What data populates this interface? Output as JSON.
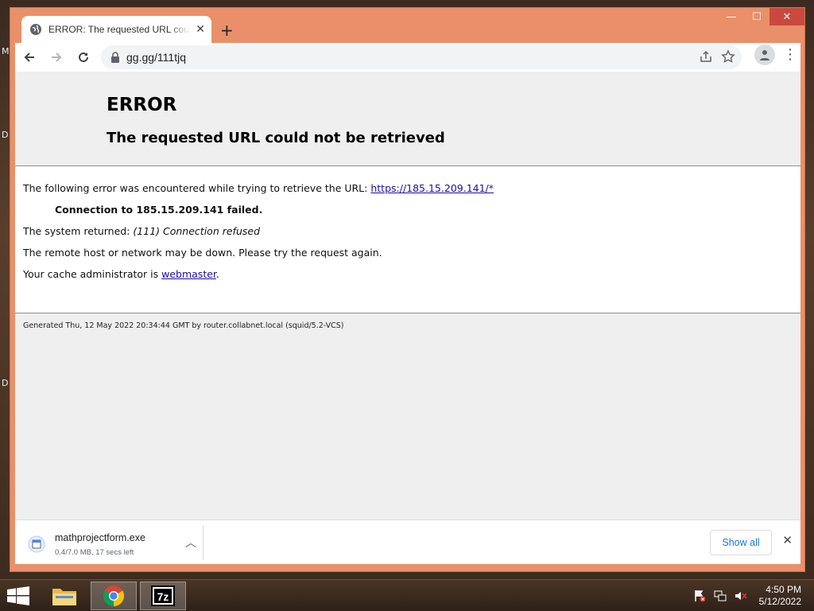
{
  "desktop": {
    "side_letters": [
      "M",
      "D",
      "D"
    ]
  },
  "browser": {
    "tab": {
      "title": "ERROR: The requested URL could not be retrieved",
      "close": "✕"
    },
    "new_tab": "+",
    "window_controls": {
      "minimize": "—",
      "maximize": "☐",
      "close": "✕"
    },
    "address": "gg.gg/111tjq",
    "menu": "⋮"
  },
  "page": {
    "title": "ERROR",
    "subtitle": "The requested URL could not be retrieved",
    "line1_prefix": "The following error was encountered while trying to retrieve the URL: ",
    "line1_link": "https://185.15.209.141/*",
    "connection": "Connection to 185.15.209.141 failed.",
    "system_prefix": "The system returned: ",
    "system_value": "(111) Connection refused",
    "remote": "The remote host or network may be down. Please try the request again.",
    "admin_prefix": "Your cache administrator is ",
    "admin_link": "webmaster",
    "admin_suffix": ".",
    "footer": "Generated Thu, 12 May 2022 20:34:44 GMT by router.collabnet.local (squid/5.2-VCS)"
  },
  "download": {
    "filename": "mathprojectform.exe",
    "status": "0.4/7.0 MB, 17 secs left",
    "show_all": "Show all",
    "close": "✕"
  },
  "taskbar": {
    "apps": [
      "file-explorer",
      "chrome",
      "7zip"
    ],
    "sevenzip_label": "7z",
    "time": "4:50 PM",
    "date": "5/12/2022"
  }
}
